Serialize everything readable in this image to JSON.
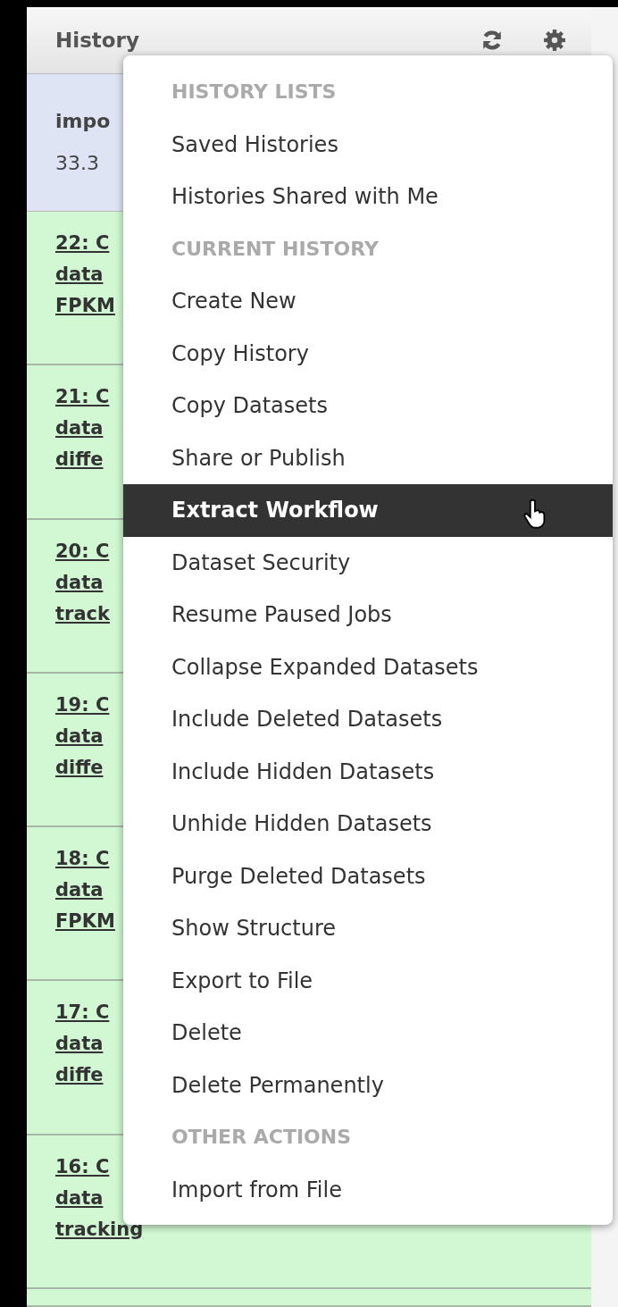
{
  "panel": {
    "title": "History"
  },
  "current_history": {
    "name": "impo",
    "size": "33.3"
  },
  "datasets": [
    {
      "lines": [
        "22: C",
        "data",
        "FPKM"
      ]
    },
    {
      "lines": [
        "21: C",
        "data",
        "diffe"
      ]
    },
    {
      "lines": [
        "20: C",
        "data",
        "track"
      ]
    },
    {
      "lines": [
        "19: C",
        "data",
        "diffe"
      ]
    },
    {
      "lines": [
        "18: C",
        "data",
        "FPKM"
      ]
    },
    {
      "lines": [
        "17: C",
        "data",
        "diffe"
      ]
    },
    {
      "lines": [
        "16: C",
        "data",
        "tracking"
      ]
    }
  ],
  "menu": {
    "items": [
      {
        "kind": "header",
        "label": "HISTORY LISTS"
      },
      {
        "kind": "option",
        "label": "Saved Histories",
        "selected": false
      },
      {
        "kind": "option",
        "label": "Histories Shared with Me",
        "selected": false
      },
      {
        "kind": "header",
        "label": "CURRENT HISTORY"
      },
      {
        "kind": "option",
        "label": "Create New",
        "selected": false
      },
      {
        "kind": "option",
        "label": "Copy History",
        "selected": false
      },
      {
        "kind": "option",
        "label": "Copy Datasets",
        "selected": false
      },
      {
        "kind": "option",
        "label": "Share or Publish",
        "selected": false
      },
      {
        "kind": "option",
        "label": "Extract Workflow",
        "selected": true
      },
      {
        "kind": "option",
        "label": "Dataset Security",
        "selected": false
      },
      {
        "kind": "option",
        "label": "Resume Paused Jobs",
        "selected": false
      },
      {
        "kind": "option",
        "label": "Collapse Expanded Datasets",
        "selected": false
      },
      {
        "kind": "option",
        "label": "Include Deleted Datasets",
        "selected": false
      },
      {
        "kind": "option",
        "label": "Include Hidden Datasets",
        "selected": false
      },
      {
        "kind": "option",
        "label": "Unhide Hidden Datasets",
        "selected": false
      },
      {
        "kind": "option",
        "label": "Purge Deleted Datasets",
        "selected": false
      },
      {
        "kind": "option",
        "label": "Show Structure",
        "selected": false
      },
      {
        "kind": "option",
        "label": "Export to File",
        "selected": false
      },
      {
        "kind": "option",
        "label": "Delete",
        "selected": false
      },
      {
        "kind": "option",
        "label": "Delete Permanently",
        "selected": false
      },
      {
        "kind": "header",
        "label": "OTHER ACTIONS"
      },
      {
        "kind": "option",
        "label": "Import from File",
        "selected": false
      }
    ]
  }
}
